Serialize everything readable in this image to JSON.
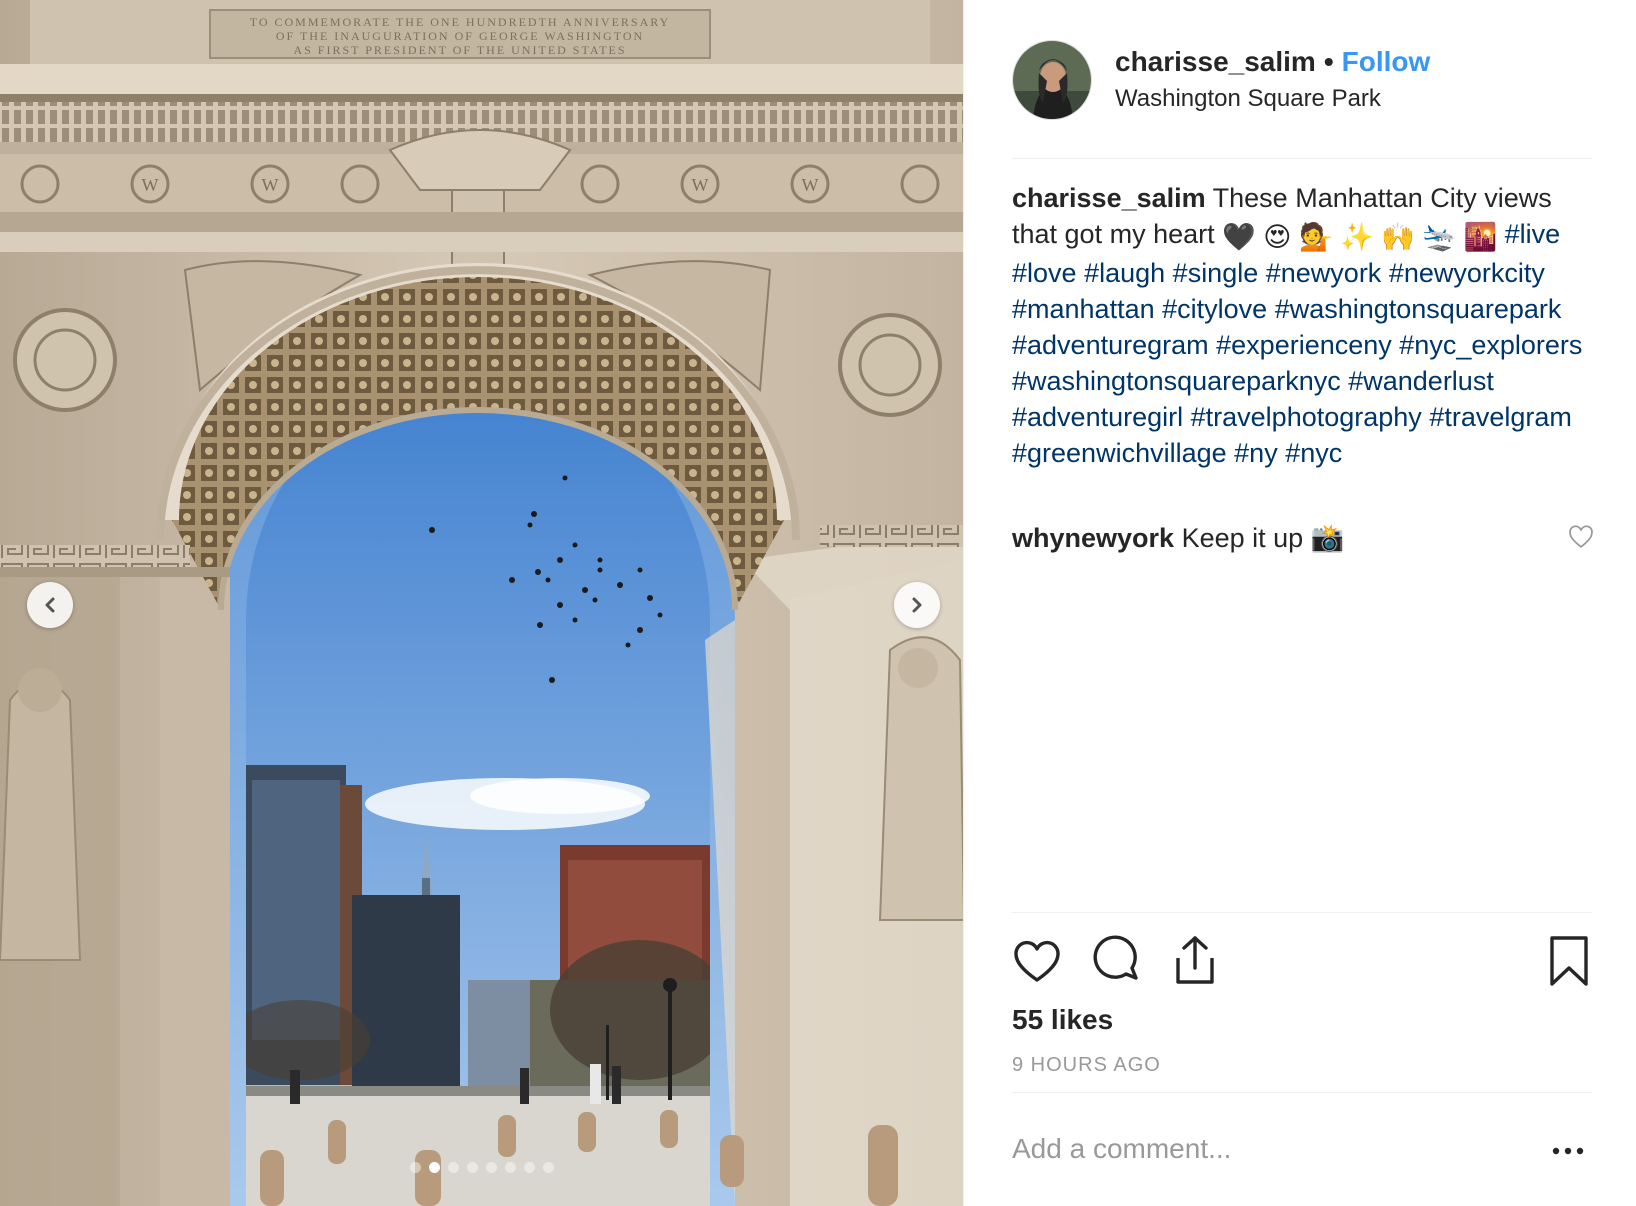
{
  "post": {
    "username": "charisse_salim",
    "separator": "•",
    "follow_label": "Follow",
    "location": "Washington Square Park",
    "caption": {
      "username": "charisse_salim",
      "text": "These Manhattan City views that got my heart",
      "emoji": [
        "🖤",
        "😍",
        "💁",
        "✨",
        "🙌",
        "🛬",
        "🌇"
      ],
      "hashtags": [
        "#live",
        "#love",
        "#laugh",
        "#single",
        "#newyork",
        "#newyorkcity",
        "#manhattan",
        "#citylove",
        "#washingtonsquarepark",
        "#adventuregram",
        "#experienceny",
        "#nyc_explorers",
        "#washingtonsquareparknyc",
        "#wanderlust",
        "#adventuregirl",
        "#travelphotography",
        "#travelgram",
        "#greenwichvillage",
        "#ny",
        "#nyc"
      ]
    },
    "comments": [
      {
        "username": "whynewyork",
        "text": "Keep it up",
        "emoji": "📸"
      }
    ],
    "likes_text": "55 likes",
    "time_ago": "9 HOURS AGO",
    "add_comment_placeholder": "Add a comment...",
    "carousel": {
      "count": 8,
      "active_index": 1
    },
    "photo_inscription": "TO COMMEMORATE THE ONE HUNDREDTH ANNIVERSARY OF THE INAUGURATION OF GEORGE WASHINGTON AS FIRST PRESIDENT OF THE UNITED STATES"
  },
  "icons": {
    "prev": "chevron-left-icon",
    "next": "chevron-right-icon",
    "like": "heart-icon",
    "comment": "speech-bubble-icon",
    "share": "share-icon",
    "save": "bookmark-icon",
    "more": "ellipsis-icon"
  },
  "colors": {
    "link_blue": "#3897f0",
    "hashtag": "#003569",
    "muted": "#999999",
    "text": "#262626"
  }
}
